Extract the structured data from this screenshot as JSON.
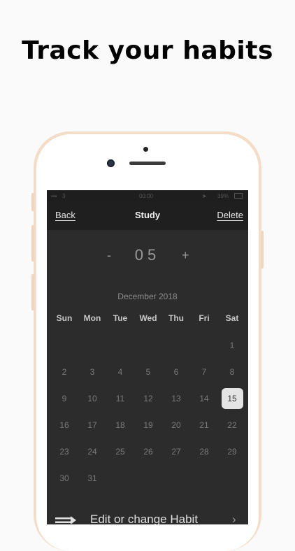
{
  "headline": "Track your habits",
  "status": {
    "carrier": "3",
    "time": "00:00",
    "battery": "39%"
  },
  "nav": {
    "back": "Back",
    "title": "Study",
    "delete": "Delete"
  },
  "counter": {
    "minus": "-",
    "value": "05",
    "plus": "+"
  },
  "calendar": {
    "month": "December 2018",
    "weekdays": [
      "Sun",
      "Mon",
      "Tue",
      "Wed",
      "Thu",
      "Fri",
      "Sat"
    ],
    "weeks": [
      [
        "",
        "",
        "",
        "",
        "",
        "",
        "1"
      ],
      [
        "2",
        "3",
        "4",
        "5",
        "6",
        "7",
        "8"
      ],
      [
        "9",
        "10",
        "11",
        "12",
        "13",
        "14",
        "15"
      ],
      [
        "16",
        "17",
        "18",
        "19",
        "20",
        "21",
        "22"
      ],
      [
        "23",
        "24",
        "25",
        "26",
        "27",
        "28",
        "29"
      ],
      [
        "30",
        "31",
        "",
        "",
        "",
        "",
        ""
      ]
    ],
    "selected": "15"
  },
  "footer": {
    "label": "Edit or change Habit",
    "chevron": "›"
  },
  "icons": {
    "arrow": "arrow-right-icon",
    "chevron": "chevron-right-icon"
  },
  "colors": {
    "screen_bg": "#2c2c2c",
    "nav_bg": "#1f1f1f",
    "selected_bg": "#e4e4e4",
    "frame": "#f3dcc8"
  }
}
